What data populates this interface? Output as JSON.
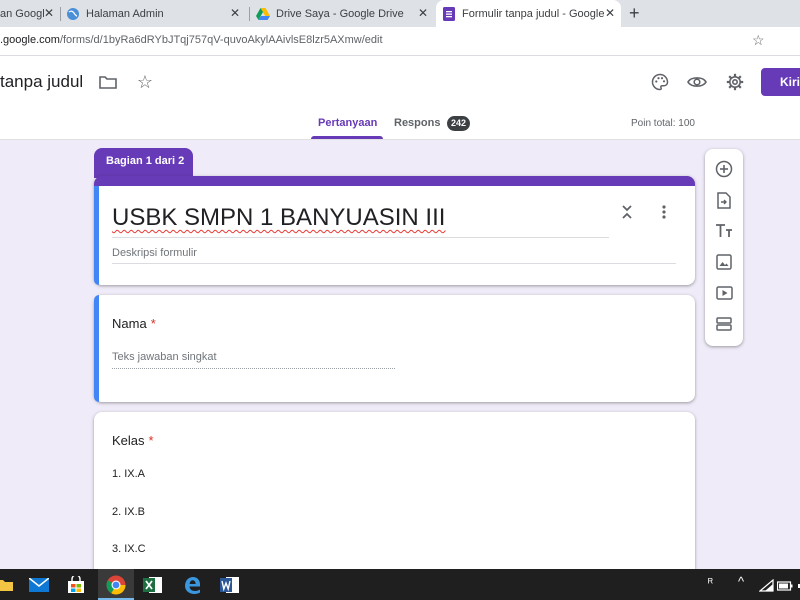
{
  "browser": {
    "tabs": [
      {
        "title": "an Googl",
        "close": "✕"
      },
      {
        "title": "Halaman Admin",
        "close": "✕"
      },
      {
        "title": "Drive Saya - Google Drive",
        "close": "✕"
      },
      {
        "title": "Formulir tanpa judul - Google Fo",
        "close": "✕",
        "active": true
      }
    ],
    "new_tab": "+",
    "url_host": ".google.com",
    "url_path": "/forms/d/1byRa6dRYbJTqj757qV-quvoAkylAAivlsE8lzr5AXmw/edit"
  },
  "header": {
    "doc_title": "tanpa judul",
    "send_label": "Kirim",
    "tabs": [
      {
        "label": "Pertanyaan"
      },
      {
        "label": "Respons"
      }
    ],
    "response_count": "242",
    "points_total": "Poin total: 100"
  },
  "form": {
    "section_label": "Bagian 1 dari 2",
    "title": "USBK SMPN 1 BANYUASIN III",
    "description_placeholder": "Deskripsi formulir",
    "questions": [
      {
        "label": "Nama",
        "required_mark": "*",
        "answer_hint": "Teks jawaban singkat"
      },
      {
        "label": "Kelas",
        "required_mark": "*",
        "options": [
          "1.  IX.A",
          "2.  IX.B",
          "3.  IX.C"
        ]
      }
    ]
  },
  "taskbar": {
    "tray_text": "ᴿ"
  },
  "colors": {
    "accent": "#673ab7",
    "focus_bar": "#4285f4",
    "required": "#d93025",
    "background": "#f0ebf8"
  }
}
